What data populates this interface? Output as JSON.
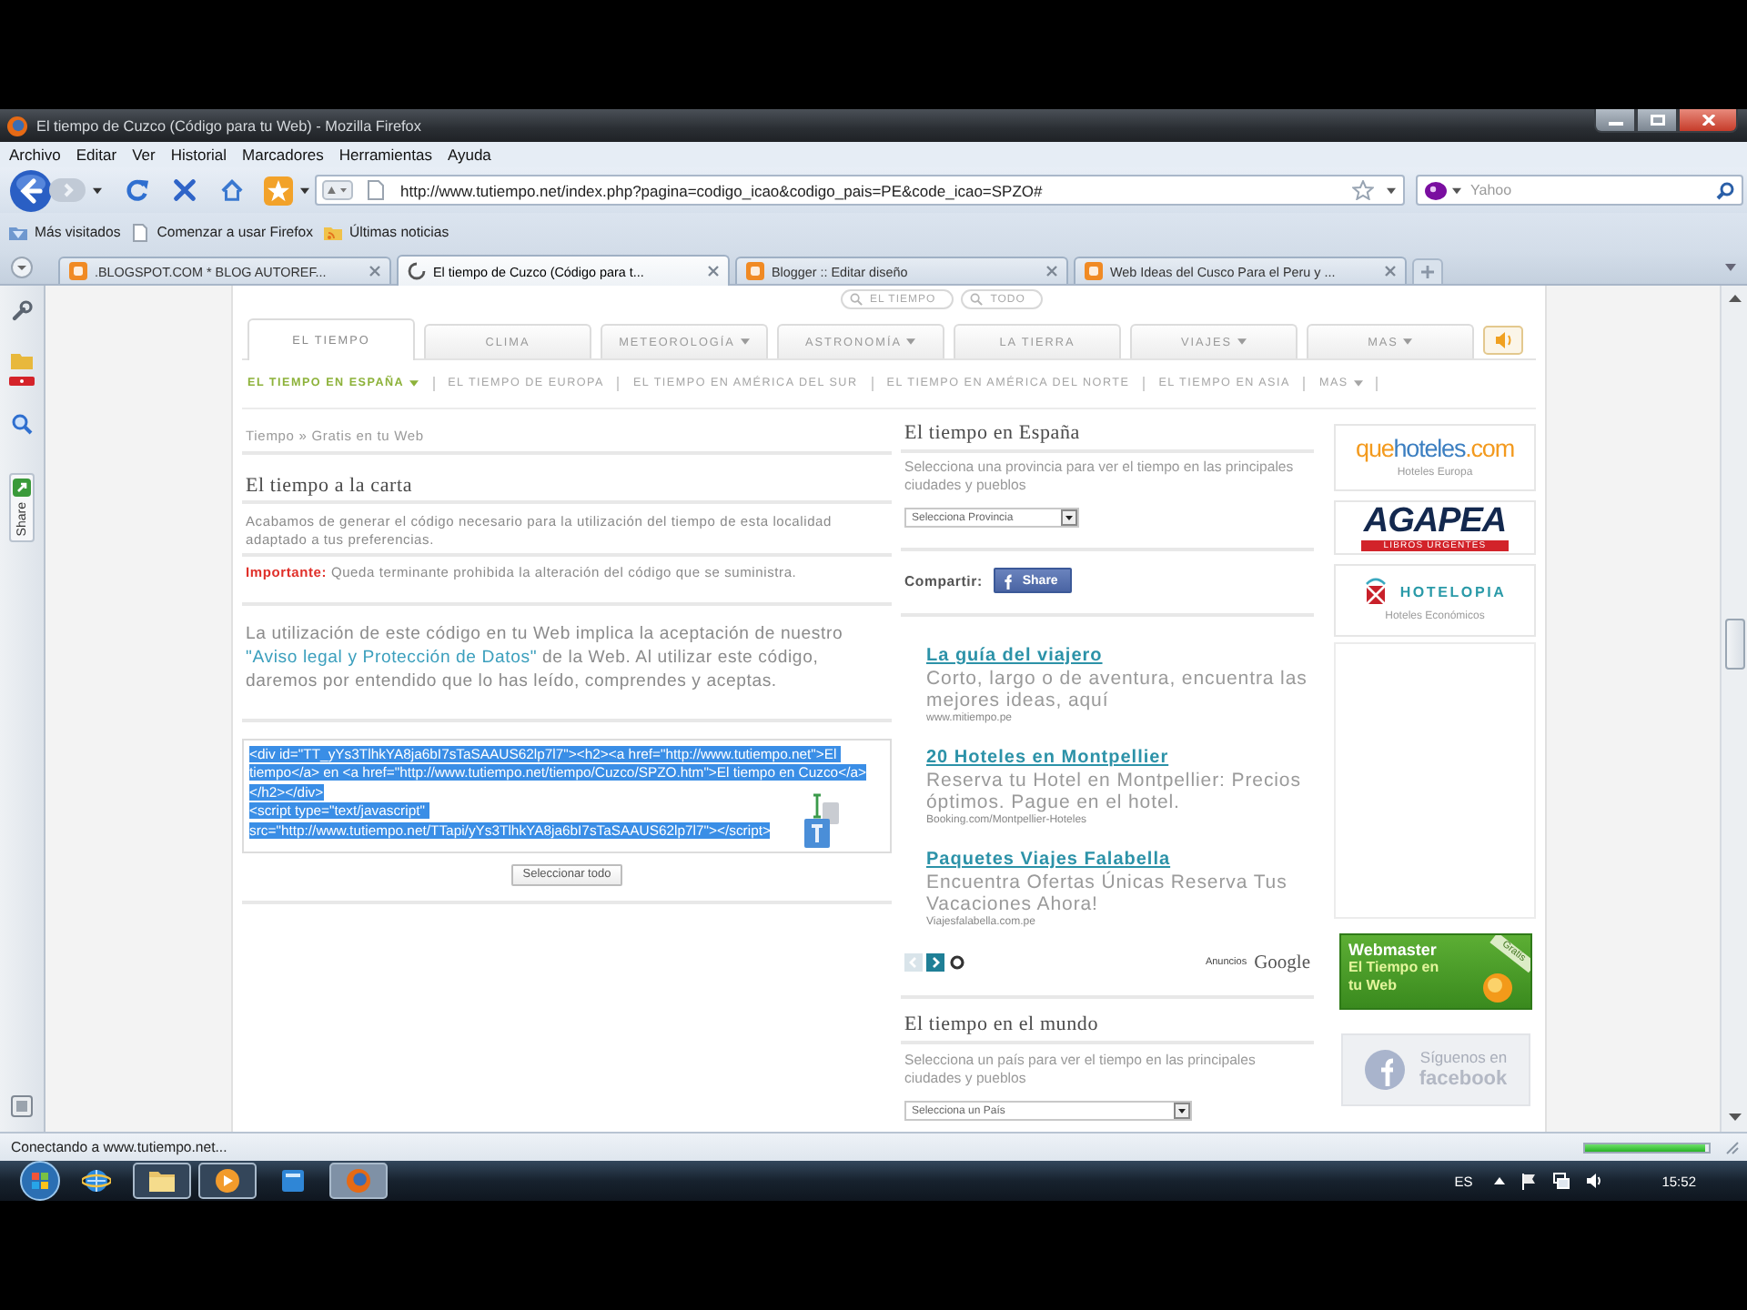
{
  "window": {
    "title": "El tiempo de Cuzco (Código para tu Web) - Mozilla Firefox"
  },
  "menu": [
    "Archivo",
    "Editar",
    "Ver",
    "Historial",
    "Marcadores",
    "Herramientas",
    "Ayuda"
  ],
  "toolbar": {
    "url": "http://www.tutiempo.net/index.php?pagina=codigo_icao&codigo_pais=PE&code_icao=SPZO#",
    "search": {
      "placeholder": "Yahoo"
    }
  },
  "bookmarks": [
    {
      "label": "Más visitados",
      "kind": "smart"
    },
    {
      "label": "Comenzar a usar Firefox",
      "kind": "page"
    },
    {
      "label": "Últimas noticias",
      "kind": "feed"
    }
  ],
  "tabs": [
    {
      "title": ".BLOGSPOT.COM * BLOG AUTOREF...",
      "selected": false,
      "loading": false
    },
    {
      "title": "El tiempo de Cuzco (Código para t...",
      "selected": true,
      "loading": true
    },
    {
      "title": "Blogger :: Editar diseño",
      "selected": false,
      "loading": false
    },
    {
      "title": "Web Ideas del Cusco Para el Peru y ...",
      "selected": false,
      "loading": false
    }
  ],
  "sidebar": {
    "share_label": "Share"
  },
  "site": {
    "search_scopes": [
      "EL TIEMPO",
      "TODO"
    ],
    "nav_tabs": [
      {
        "label": "EL TIEMPO",
        "selected": true,
        "dropdown": false
      },
      {
        "label": "CLIMA",
        "selected": false,
        "dropdown": false
      },
      {
        "label": "METEOROLOGÍA",
        "selected": false,
        "dropdown": true
      },
      {
        "label": "ASTRONOMÍA",
        "selected": false,
        "dropdown": true
      },
      {
        "label": "LA TIERRA",
        "selected": false,
        "dropdown": false
      },
      {
        "label": "VIAJES",
        "selected": false,
        "dropdown": true
      },
      {
        "label": "MAS",
        "selected": false,
        "dropdown": true
      }
    ],
    "subnav": [
      {
        "label": "EL TIEMPO EN ESPAÑA",
        "selected": true,
        "dropdown": true
      },
      {
        "label": "EL TIEMPO DE EUROPA",
        "selected": false,
        "dropdown": false
      },
      {
        "label": "EL TIEMPO EN AMÉRICA DEL SUR",
        "selected": false,
        "dropdown": false
      },
      {
        "label": "EL TIEMPO EN AMÉRICA DEL NORTE",
        "selected": false,
        "dropdown": false
      },
      {
        "label": "EL TIEMPO EN ASIA",
        "selected": false,
        "dropdown": false
      },
      {
        "label": "MAS",
        "selected": false,
        "dropdown": true
      }
    ],
    "breadcrumb": "Tiempo » Gratis en tu Web",
    "heading": "El tiempo a la carta",
    "intro": "Acabamos de generar el código necesario para la utilización del tiempo de esta localidad adaptado a tus preferencias.",
    "warning": "**Importante:** Queda terminante prohibida la alteración del código que se suministra.",
    "notice": {
      "before": "La utilización de este código en tu Web implica la aceptación de nuestro",
      "link": "\"Aviso legal y Protección de Datos\"",
      "after": "de la Web. Al utilizar este código, daremos por entendido que lo has leído, comprendes y aceptas."
    },
    "code_box": {
      "code": "<div id=\"TT_yYs3TlhkYA8ja6bI7sTaSAAUS62lp7l7\"><h2><a href=\"http://www.tutiempo.net\">El tiempo</a> en <a href=\"http://www.tutiempo.net/tiempo/Cuzco/SPZO.htm\">El tiempo en Cuzco</a></h2></div>\n<script type=\"text/javascript\" src=\"http://www.tutiempo.net/TTapi/yYs3TlhkYA8ja6bI7sTaSAAUS62lp7l7\"></script>",
      "selected": true
    },
    "select_all_button": "Seleccionar todo",
    "spain": {
      "heading": "El tiempo en España",
      "hint": "Selecciona una provincia para ver el tiempo en las principales ciudades y pueblos",
      "select": "Selecciona Provincia"
    },
    "share": {
      "label": "Compartir:",
      "button": "Share"
    },
    "ads": [
      {
        "title": "La guía del viajero",
        "text": "Corto, largo o de aventura, encuentra las mejores ideas, aquí",
        "url": "www.mitiempo.pe"
      },
      {
        "title": "20 Hoteles en Montpellier",
        "text": "Reserva tu Hotel en Montpellier: Precios óptimos. Pague en el hotel.",
        "url": "Booking.com/Montpellier-Hoteles"
      },
      {
        "title": "Paquetes Viajes Falabella",
        "text": "Encuentra Ofertas Únicas Reserva Tus Vacaciones Ahora!",
        "url": "Viajesfalabella.com.pe"
      }
    ],
    "ads_label": "Anuncios",
    "ads_brand": "Google",
    "world": {
      "heading": "El tiempo en el mundo",
      "hint": "Selecciona un país para ver el tiempo en las principales ciudades y pueblos",
      "select": "Selecciona un País"
    },
    "banners": [
      {
        "kind": "quehoteles",
        "logo": [
          "que",
          "hoteles",
          ".com"
        ],
        "caption": "Hoteles Europa"
      },
      {
        "kind": "agapea",
        "logo": [
          "AGAPEA"
        ],
        "caption": "LIBROS URGENTES"
      },
      {
        "kind": "hotelopia",
        "logo": [
          "HOTELOPIA"
        ],
        "caption": "Hoteles Económicos"
      },
      {
        "kind": "webmaster",
        "logo": [
          "Webmaster"
        ],
        "caption": "El Tiempo en tu Web",
        "ribbon": "Gratis"
      },
      {
        "kind": "facebook",
        "logo": [
          "facebook"
        ],
        "caption": "Síguenos en"
      }
    ]
  },
  "status_bar": {
    "text": "Conectando a www.tutiempo.net...",
    "level": 0.97
  },
  "taskbar": {
    "apps": [
      {
        "kind": "ie",
        "running": false,
        "selected": false
      },
      {
        "kind": "folder",
        "running": true,
        "selected": false
      },
      {
        "kind": "media",
        "running": true,
        "selected": false
      },
      {
        "kind": "window",
        "running": false,
        "selected": false
      },
      {
        "kind": "firefox",
        "running": true,
        "selected": true
      }
    ],
    "language": "ES",
    "clock": "15:52"
  }
}
